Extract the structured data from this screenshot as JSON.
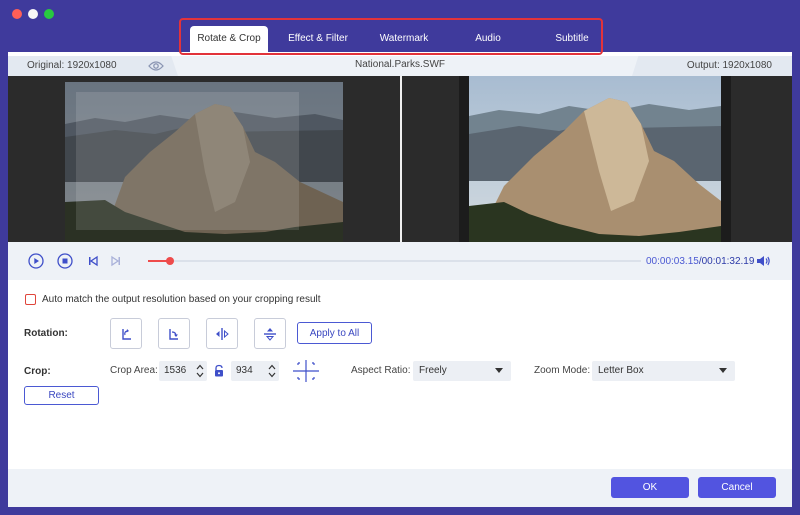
{
  "tabs": [
    {
      "label": "Rotate & Crop",
      "active": true
    },
    {
      "label": "Effect & Filter",
      "active": false
    },
    {
      "label": "Watermark",
      "active": false
    },
    {
      "label": "Audio",
      "active": false
    },
    {
      "label": "Subtitle",
      "active": false
    }
  ],
  "info": {
    "original": "Original: 1920x1080",
    "file_name": "National.Parks.SWF",
    "output": "Output: 1920x1080"
  },
  "playback": {
    "current_time": "00:00:03.15",
    "total_time": "/00:01:32.19",
    "progress_fraction": 0.044
  },
  "options": {
    "auto_match_label": "Auto match the output resolution based on your cropping result",
    "auto_match_checked": false
  },
  "rotation": {
    "label": "Rotation:",
    "apply_all_label": "Apply to All"
  },
  "crop": {
    "label": "Crop:",
    "area_label": "Crop Area:",
    "width": "1536",
    "height": "934",
    "aspect_label": "Aspect Ratio:",
    "aspect_value": "Freely",
    "zoom_label": "Zoom Mode:",
    "zoom_value": "Letter Box",
    "reset_label": "Reset"
  },
  "footer": {
    "ok_label": "OK",
    "cancel_label": "Cancel"
  },
  "colors": {
    "window_bg": "#3f3a9c",
    "accent": "#4b59d3",
    "highlight_red": "#e2333a",
    "progress": "#ee4b4b",
    "primary_button": "#5254e0"
  }
}
